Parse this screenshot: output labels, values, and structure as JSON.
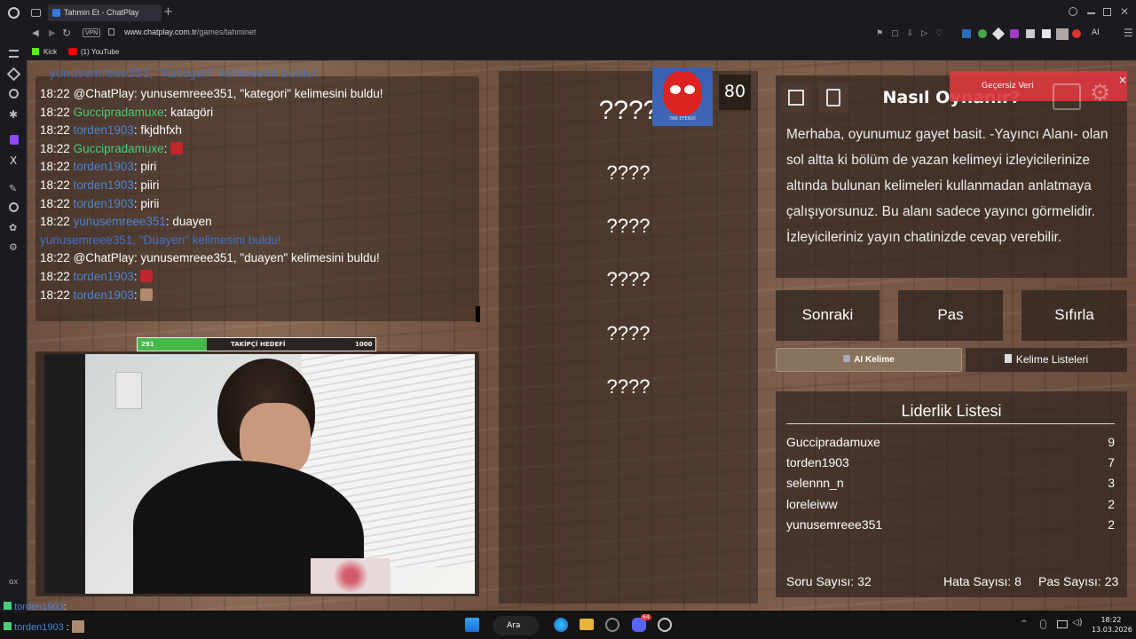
{
  "browser": {
    "tab_title": "Tahmin Et - ChatPlay",
    "vpn_label": "VPN",
    "url_domain": "www.chatplay.com.tr",
    "url_path": "/games/tahminet",
    "ai_label": "AI",
    "bookmarks": [
      "Kick",
      "(1) YouTube"
    ],
    "gx_label": "GX"
  },
  "chat": {
    "top_partial": "yunusemreee351, \"Kategori\" kelimesini buldu!",
    "lines": [
      {
        "time": "18:22",
        "user": "@ChatPlay",
        "msg": ": yunusemreee351, \"kategori\" kelimesini buldu!",
        "user_color": "plain"
      },
      {
        "time": "18:22",
        "user": "Guccipradamuxe",
        "msg": ": katagöri",
        "user_color": "green"
      },
      {
        "time": "18:22",
        "user": "torden1903",
        "msg": ": fkjdhfxh",
        "user_color": "blue"
      },
      {
        "time": "18:22",
        "user": "Guccipradamuxe",
        "msg": ": ",
        "user_color": "green",
        "emote": "red"
      },
      {
        "time": "18:22",
        "user": "torden1903",
        "msg": ": piri",
        "user_color": "blue"
      },
      {
        "time": "18:22",
        "user": "torden1903",
        "msg": ": piiri",
        "user_color": "blue"
      },
      {
        "time": "18:22",
        "user": "torden1903",
        "msg": ": pirii",
        "user_color": "blue"
      },
      {
        "time": "18:22",
        "user": "yunusemreee351",
        "msg": ": duayen",
        "user_color": "blue"
      },
      {
        "time": "",
        "user": "yunusemreee351, \"Duayen\" kelimesini buldu!",
        "msg": "",
        "user_color": "system"
      },
      {
        "time": "18:22",
        "user": "@ChatPlay",
        "msg": ": yunusemreee351, \"duayen\" kelimesini buldu!",
        "user_color": "plain"
      },
      {
        "time": "18:22",
        "user": "torden1903",
        "msg": ": ",
        "user_color": "blue",
        "emote": "spider"
      },
      {
        "time": "18:22",
        "user": "torden1903",
        "msg": ": ",
        "user_color": "blue",
        "emote": "face"
      }
    ]
  },
  "goal": {
    "current": "291",
    "label": "TAKİPÇİ HEDEFİ",
    "target": "1000",
    "progress": 0.291
  },
  "words": {
    "score": "80",
    "avatar_caption": "TAB EFENDİ",
    "items": [
      "????",
      "????",
      "????",
      "????",
      "????",
      "????"
    ]
  },
  "info": {
    "title": "Nasıl Oynanır?",
    "text": "Merhaba, oyunumuz gayet basit. -Yayıncı Alanı- olan sol altta ki bölüm de yazan kelimeyi izleyicilerinize altında bulunan kelimeleri kullanmadan anlatmaya çalışıyorsunuz. Bu alanı sadece yayıncı görmelidir. İzleyicileriniz yayın chatinizde cevap verebilir.",
    "toast": "Geçersiz Veri",
    "toast_close": "×"
  },
  "controls": {
    "next": "Sonraki",
    "pass": "Pas",
    "reset": "Sıfırla",
    "ai_word": "AI Kelime",
    "word_lists": "Kelime Listeleri"
  },
  "leaderboard": {
    "title": "Liderlik Listesi",
    "rows": [
      {
        "name": "Guccipradamuxe",
        "score": "9"
      },
      {
        "name": "torden1903",
        "score": "7"
      },
      {
        "name": "selennn_n",
        "score": "3"
      },
      {
        "name": "loreleiww",
        "score": "2"
      },
      {
        "name": "yunusemreee351",
        "score": "2"
      }
    ],
    "questions_label": "Soru Sayısı:",
    "questions": "32",
    "errors_label": "Hata Sayısı:",
    "errors": "8",
    "passes_label": "Pas Sayısı:",
    "passes": "23"
  },
  "overlay_chat": [
    {
      "user": "torden1903",
      "sep": ":"
    },
    {
      "user": "torden1903",
      "sep": ":"
    }
  ],
  "taskbar": {
    "search": "Ara",
    "time": "18:22",
    "date": "13.03.2026",
    "badge": "64"
  },
  "colors": {
    "accent_green": "#4bcf7a",
    "chat_blue": "#4a86d6",
    "toast_red": "#d9383f"
  }
}
